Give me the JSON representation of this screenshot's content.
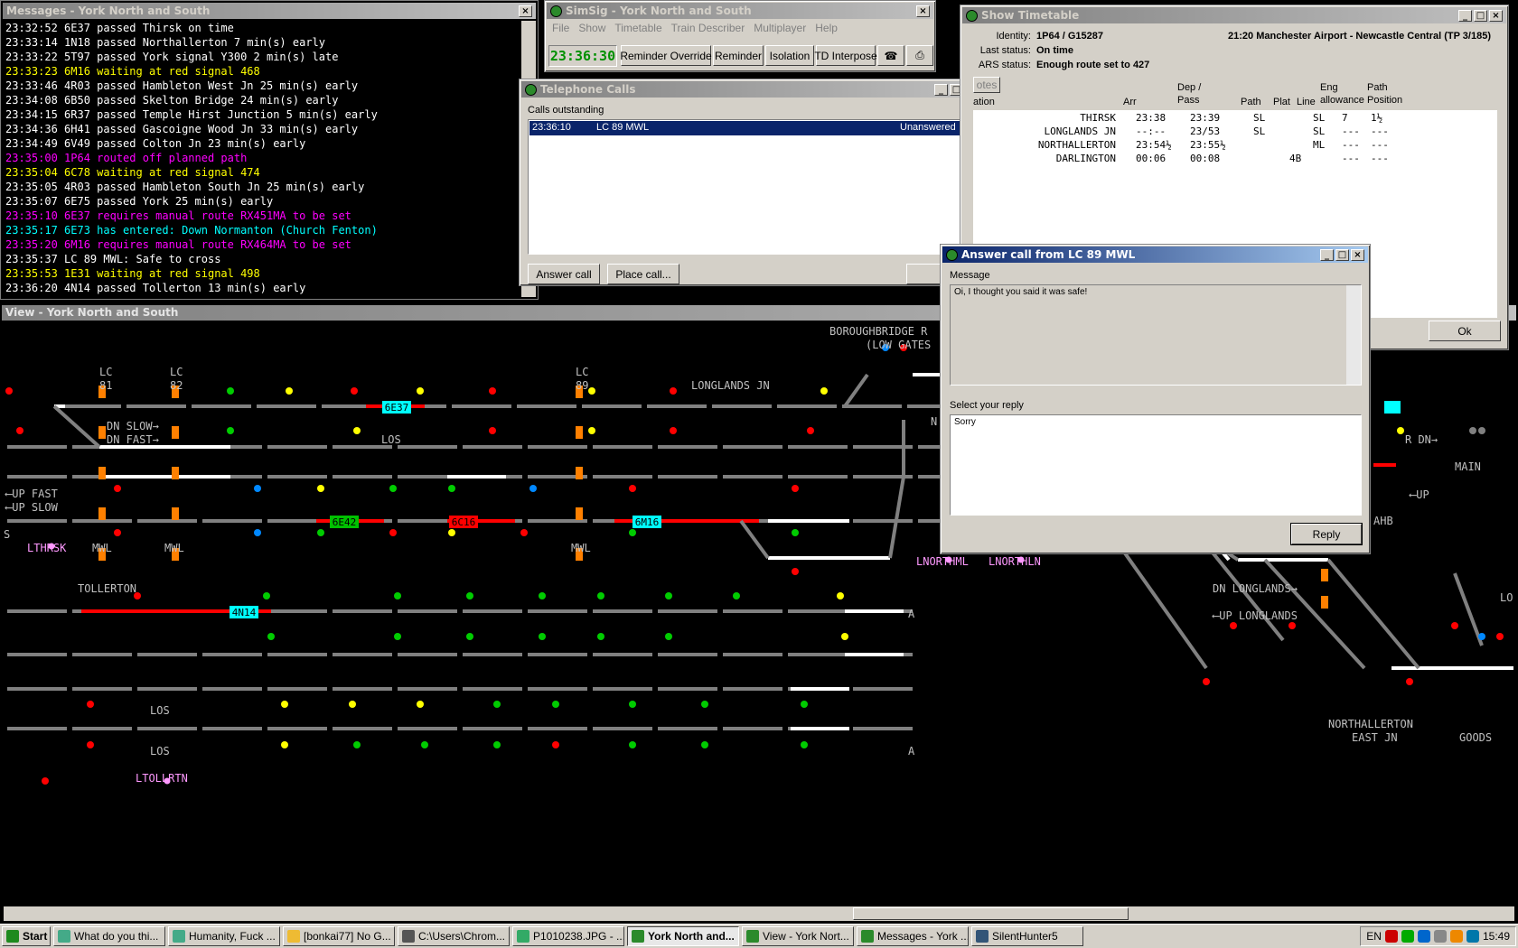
{
  "messages": {
    "title": "Messages - York North and South",
    "lines": [
      {
        "text": "23:32:52 6E37 passed Thirsk on time",
        "color": "#ffffff"
      },
      {
        "text": "23:33:14 1N18 passed Northallerton 7 min(s) early",
        "color": "#ffffff"
      },
      {
        "text": "23:33:22 5T97 passed York signal Y300 2 min(s) late",
        "color": "#ffffff"
      },
      {
        "text": "23:33:23 6M16 waiting at red signal 468",
        "color": "#ffff00"
      },
      {
        "text": "23:33:46 4R03 passed Hambleton West Jn 25 min(s) early",
        "color": "#ffffff"
      },
      {
        "text": "23:34:08 6B50 passed Skelton Bridge 24 min(s) early",
        "color": "#ffffff"
      },
      {
        "text": "23:34:15 6R37 passed Temple Hirst Junction 5 min(s) early",
        "color": "#ffffff"
      },
      {
        "text": "23:34:36 6H41 passed Gascoigne Wood Jn 33 min(s) early",
        "color": "#ffffff"
      },
      {
        "text": "23:34:49 6V49 passed Colton Jn 23 min(s) early",
        "color": "#ffffff"
      },
      {
        "text": "23:35:00 1P64 routed off planned path",
        "color": "#ff00ff"
      },
      {
        "text": "23:35:04 6C78 waiting at red signal 474",
        "color": "#ffff00"
      },
      {
        "text": "23:35:05 4R03 passed Hambleton South Jn 25 min(s) early",
        "color": "#ffffff"
      },
      {
        "text": "23:35:07 6E75 passed York 25 min(s) early",
        "color": "#ffffff"
      },
      {
        "text": "23:35:10 6E37 requires manual route RX451MA to be set",
        "color": "#ff00ff"
      },
      {
        "text": "23:35:17 6E73 has entered: Down Normanton (Church Fenton)",
        "color": "#00ffff"
      },
      {
        "text": "23:35:20 6M16 requires manual route RX464MA to be set",
        "color": "#ff00ff"
      },
      {
        "text": "23:35:37 LC 89 MWL: Safe to cross",
        "color": "#ffffff"
      },
      {
        "text": "23:35:53 1E31 waiting at red signal 498",
        "color": "#ffff00"
      },
      {
        "text": "23:36:20 4N14 passed Tollerton 13 min(s) early",
        "color": "#ffffff"
      }
    ]
  },
  "simsig": {
    "title": "SimSig - York North and South",
    "menu": [
      "File",
      "Show",
      "Timetable",
      "Train Describer",
      "Multiplayer",
      "Help"
    ],
    "clock": "23:36:30",
    "buttons": [
      "Reminder Override",
      "Reminder",
      "Isolation",
      "TD Interpose"
    ]
  },
  "phone": {
    "title": "Telephone Calls",
    "outstanding_label": "Calls outstanding",
    "call": {
      "time": "23:36:10",
      "caller": "LC 89 MWL",
      "status": "Unanswered"
    },
    "answer": "Answer call",
    "place": "Place call...",
    "close": "Cl"
  },
  "timetable": {
    "title": "Show Timetable",
    "identity_label": "Identity:",
    "identity": "1P64 / G15287",
    "last_status_label": "Last status:",
    "last_status": "On time",
    "ars_label": "ARS status:",
    "ars": "Enough route set to 427",
    "service": "21:20 Manchester Airport - Newcastle Central (TP 3/185)",
    "notes": "otes",
    "headers": [
      "ation",
      "Arr",
      "Dep / Pass",
      "Path",
      "Plat",
      "Line",
      "Eng allowance",
      "Path Position"
    ],
    "rows": [
      [
        "THIRSK",
        "23:38",
        "23:39",
        "SL",
        "",
        "SL",
        "7",
        "1½"
      ],
      [
        "LONGLANDS JN",
        "--:--",
        "23/53",
        "SL",
        "",
        "SL",
        "---",
        "---"
      ],
      [
        "NORTHALLERTON",
        "23:54½",
        "23:55½",
        "",
        "",
        "ML",
        "---",
        "---"
      ],
      [
        "DARLINGTON",
        "00:06",
        "00:08",
        "",
        "4B",
        "",
        "---",
        "---"
      ]
    ],
    "ok": "Ok"
  },
  "answer_dialog": {
    "title": "Answer call from LC 89 MWL",
    "message_label": "Message",
    "message": "Oi, I thought you said it was safe!",
    "reply_label": "Select your reply",
    "reply": "Sorry",
    "reply_button": "Reply"
  },
  "view": {
    "title": "View - York North and South"
  },
  "diagram": {
    "labels": [
      {
        "t": "LC",
        "c": "#c0c0c0"
      },
      {
        "t": "81",
        "c": "#c0c0c0"
      },
      {
        "t": "LC",
        "c": "#c0c0c0"
      },
      {
        "t": "82",
        "c": "#c0c0c0"
      },
      {
        "t": "LC",
        "c": "#c0c0c0"
      },
      {
        "t": "89",
        "c": "#c0c0c0"
      },
      {
        "t": "LONGLANDS JN",
        "c": "#c0c0c0"
      },
      {
        "t": "BOROUGHBRIDGE R",
        "c": "#c0c0c0"
      },
      {
        "t": "(LOW GATES",
        "c": "#c0c0c0"
      },
      {
        "t": "DN SLOW→",
        "c": "#c0c0c0"
      },
      {
        "t": "DN FAST→",
        "c": "#c0c0c0"
      },
      {
        "t": "⟵UP FAST",
        "c": "#c0c0c0"
      },
      {
        "t": "⟵UP SLOW",
        "c": "#c0c0c0"
      },
      {
        "t": "LTHRSK",
        "c": "#ff99ff"
      },
      {
        "t": "MWL",
        "c": "#c0c0c0"
      },
      {
        "t": "MWL",
        "c": "#c0c0c0"
      },
      {
        "t": "MWL",
        "c": "#c0c0c0"
      },
      {
        "t": "LNORTHML",
        "c": "#ff99ff"
      },
      {
        "t": "LNORTHLN",
        "c": "#ff99ff"
      },
      {
        "t": "TOLLERTON",
        "c": "#c0c0c0"
      },
      {
        "t": "LTOLLRTN",
        "c": "#ff99ff"
      },
      {
        "t": "LOS",
        "c": "#c0c0c0"
      },
      {
        "t": "LOS",
        "c": "#c0c0c0"
      },
      {
        "t": "LOS",
        "c": "#c0c0c0"
      },
      {
        "t": "DN LONGLANDS→",
        "c": "#c0c0c0"
      },
      {
        "t": "⟵UP LONGLANDS",
        "c": "#c0c0c0"
      },
      {
        "t": "NORTHALLERTON",
        "c": "#c0c0c0"
      },
      {
        "t": "EAST JN",
        "c": "#c0c0c0"
      },
      {
        "t": "GOODS",
        "c": "#c0c0c0"
      },
      {
        "t": "MAIN",
        "c": "#c0c0c0"
      },
      {
        "t": "R DN→",
        "c": "#c0c0c0"
      },
      {
        "t": "⟵UP",
        "c": "#c0c0c0"
      },
      {
        "t": "AHB",
        "c": "#c0c0c0"
      },
      {
        "t": "S",
        "c": "#c0c0c0"
      },
      {
        "t": "N",
        "c": "#c0c0c0"
      },
      {
        "t": "LO",
        "c": "#c0c0c0"
      },
      {
        "t": "A",
        "c": "#c0c0c0"
      },
      {
        "t": "A",
        "c": "#c0c0c0"
      }
    ],
    "trains": [
      {
        "t": "6E37",
        "bg": "#00ffff",
        "fg": "#000"
      },
      {
        "t": "6E42",
        "bg": "#00c000",
        "fg": "#000"
      },
      {
        "t": "6C16",
        "bg": "#ff0000",
        "fg": "#000"
      },
      {
        "t": "6M16",
        "bg": "#00ffff",
        "fg": "#000"
      },
      {
        "t": "4N14",
        "bg": "#00ffff",
        "fg": "#000"
      }
    ]
  },
  "taskbar": {
    "start": "Start",
    "tasks": [
      "What do you thi...",
      "Humanity, Fuck ...",
      "[bonkai77] No G...",
      "C:\\Users\\Chrom...",
      "P1010238.JPG - ...",
      "York North and...",
      "View - York Nort...",
      "Messages - York ...",
      "SilentHunter5"
    ],
    "active": 5,
    "lang": "EN",
    "clock": "15:49"
  }
}
